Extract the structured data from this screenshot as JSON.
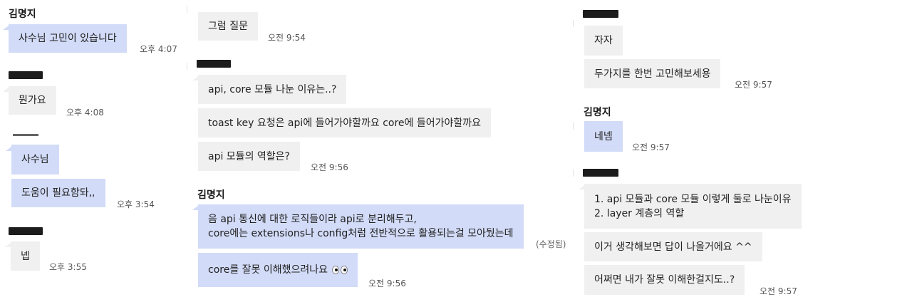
{
  "col1": {
    "name_top": "김명지",
    "msg1": {
      "text": "사수님 고민이 있습니다",
      "time": "오후 4:07"
    },
    "msg2": {
      "text": "뭔가요",
      "time": "오후 4:08"
    },
    "msg3": {
      "text": "사수님"
    },
    "msg4": {
      "text": "도움이 필요함돠,,",
      "time": "오후 3:54"
    },
    "msg5": {
      "text": "넵",
      "time": "오후 3:55"
    }
  },
  "col2": {
    "msg1": {
      "text": "그럼 질문",
      "time": "오전 9:54"
    },
    "msg2": {
      "text": "api, core 모듈 나눈 이유는..?"
    },
    "msg3": {
      "text": "toast key 요청은 api에 들어가야할까요 core에 들어가야할까요"
    },
    "msg4": {
      "text": "api 모듈의 역할은?",
      "time": "오전 9:56"
    },
    "name": "김명지",
    "msg5": {
      "line1": "음 api 통신에 대한 로직들이라 api로 분리해두고,",
      "line2": "core에는 extensions나 config처럼 전반적으로 활용되는걸 모아뒀는데",
      "edited": "(수정됨)"
    },
    "msg6": {
      "text": "core를 잘못 이해했으려나요",
      "time": "오전 9:56"
    }
  },
  "col3": {
    "msg1": {
      "text": "자자"
    },
    "msg2": {
      "text": "두가지를 한번 고민해보세용",
      "time": "오전 9:57"
    },
    "name": "김명지",
    "msg3": {
      "text": "네넴",
      "time": "오전 9:57"
    },
    "msg4": {
      "line1": "1. api 모듈과 core 모듈 이렇게 둘로 나눈이유",
      "line2": "2. layer 계층의 역할"
    },
    "msg5": {
      "text": "이거 생각해보면 답이 나올거에요 ^^"
    },
    "msg6": {
      "text": "어쩌면 내가 잘못 이해한걸지도..?",
      "time": "오전 9:57"
    }
  },
  "colors": {
    "mine_bubble": "#d2dbf7",
    "other_bubble": "#f0f0f0",
    "redaction": "#1c1c1c"
  }
}
